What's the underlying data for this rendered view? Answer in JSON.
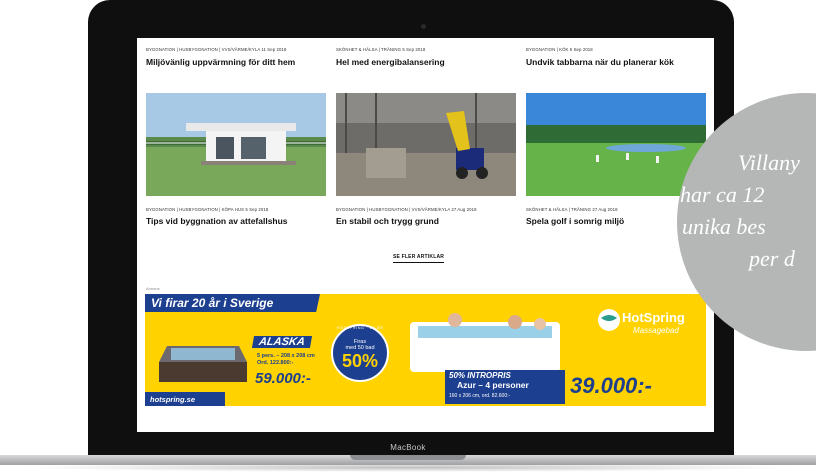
{
  "articles_top": [
    {
      "meta": "BYGGNATION  |  HUSBYGGNATION  |  VVS/VÄRME/KYLA    11 Sep 2018",
      "title": "Miljövänlig uppvärmning för ditt hem"
    },
    {
      "meta": "SKÖNHET & HÄLSA  |  TRÄNING    5 Sep 2018",
      "title": "Hel med energibalansering"
    },
    {
      "meta": "BYGGNATION  |  KÖK    5 Sep 2018",
      "title": "Undvik tabbarna när du planerar kök"
    }
  ],
  "articles_bottom": [
    {
      "meta": "BYGGNATION  |  HUSBYGGNATION  |  KÖPA HUS    5 Sep 2018",
      "title": "Tips vid byggnation av attefallshus"
    },
    {
      "meta": "BYGGNATION  |  HUSBYGGNATION  |  VVS/VÄRME/KYLA    27 Aug 2018",
      "title": "En stabil och trygg grund"
    },
    {
      "meta": "SKÖNHET & HÄLSA  |  TRÄNING    27 Aug 2018",
      "title": "Spela golf i somrig miljö"
    }
  ],
  "more_label": "SE FLER ARTIKLAR",
  "ad": {
    "label": "Annons",
    "headline": "Vi firar 20 år i Sverige",
    "model": "ALASKA",
    "spec1": "5 pers. – 208 x 208 cm",
    "spec2": "Ord. 122.800:-",
    "price1": "59.000:-",
    "site": "hotspring.se",
    "badge_ring": "HOTSPRING · 20 ÅR",
    "badge_line1": "Firas",
    "badge_line2": "med 50 bad",
    "badge_pct": "50%",
    "promo1": "50% INTROPRIS",
    "promo2": "Azur – 4 personer",
    "promo3": "160 x 206 cm, ord. 82.600:-",
    "price2": "39.000:-",
    "brand": "HotSpring",
    "brand_sub": "Massagebad"
  },
  "laptop_brand": "MacBook",
  "quote_lines": [
    "Villany",
    "har ca 12",
    "unika bes",
    "per d"
  ],
  "colors": {
    "ad_yellow": "#ffd200",
    "ad_blue": "#1d3f8f",
    "circle": "#b5b6b6"
  }
}
